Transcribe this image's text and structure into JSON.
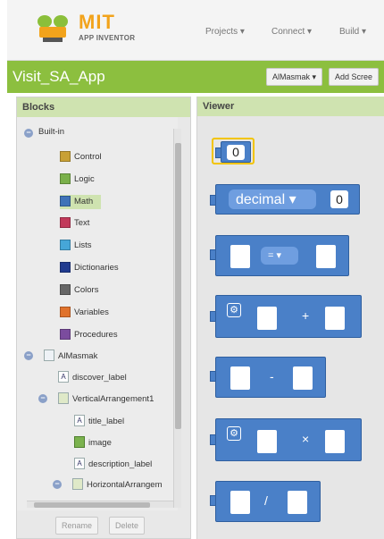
{
  "app": {
    "logo_mit": "MIT",
    "logo_sub": "APP INVENTOR"
  },
  "menu": {
    "projects": "Projects ▾",
    "connect": "Connect ▾",
    "build": "Build ▾"
  },
  "project": {
    "title": "Visit_SA_App",
    "screen_select": "AlMasmak ▾",
    "add_screen": "Add Scree"
  },
  "blocks_panel": {
    "title": "Blocks",
    "builtin_label": "Built-in",
    "builtin_items": [
      {
        "label": "Control",
        "color": "#c8a035"
      },
      {
        "label": "Logic",
        "color": "#7ab04a"
      },
      {
        "label": "Math",
        "color": "#3f73b8"
      },
      {
        "label": "Text",
        "color": "#c23a5b"
      },
      {
        "label": "Lists",
        "color": "#46a6d8"
      },
      {
        "label": "Dictionaries",
        "color": "#203a8e"
      },
      {
        "label": "Colors",
        "color": "#666666"
      },
      {
        "label": "Variables",
        "color": "#e0722c"
      },
      {
        "label": "Procedures",
        "color": "#7b4c9e"
      }
    ],
    "component_root": "AlMasmak",
    "components": [
      "discover_label",
      "VerticalArrangement1",
      "title_label",
      "image",
      "description_label",
      "HorizontalArrangem"
    ],
    "rename_button": "Rename",
    "delete_button": "Delete"
  },
  "viewer": {
    "title": "Viewer",
    "number_block_value": "0",
    "decimal_label": "decimal ▾",
    "decimal_value": "0",
    "compare_op": "= ▾",
    "plus_op": "+",
    "minus_op": "-",
    "times_op": "×",
    "divide_op": "/"
  }
}
